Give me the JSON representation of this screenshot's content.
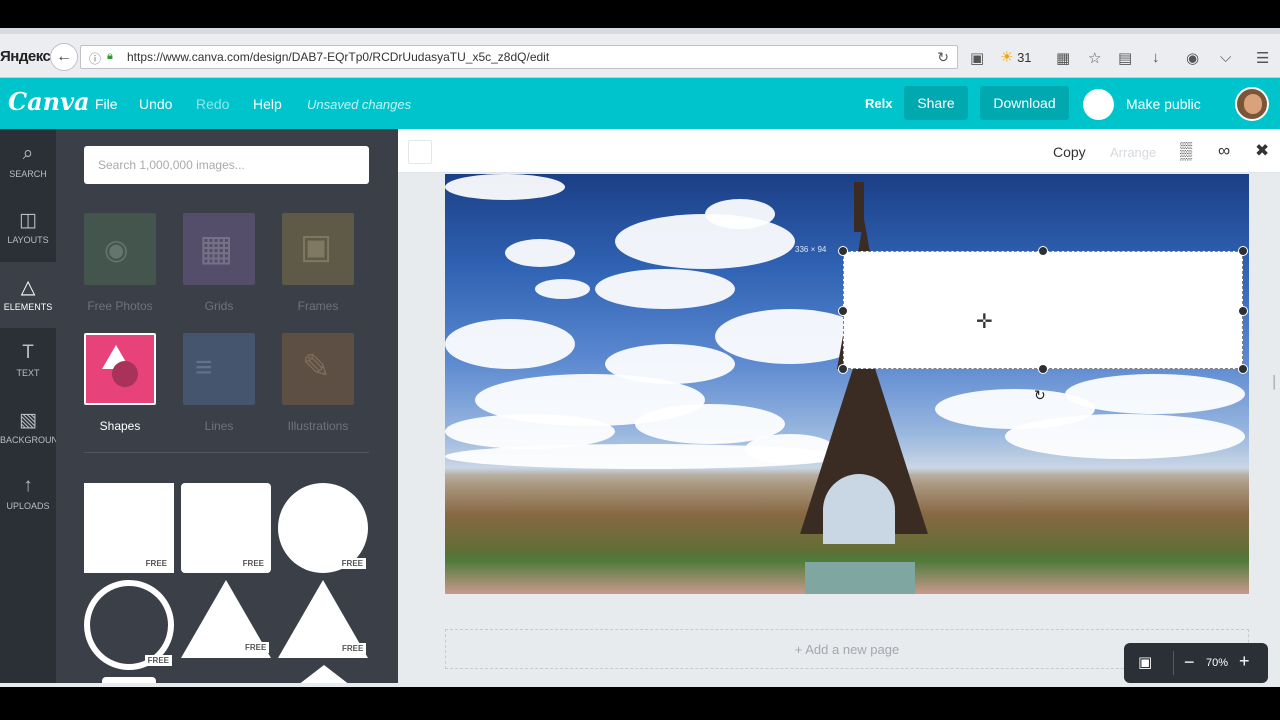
{
  "browser": {
    "brand": "Яндекс",
    "url": "https://www.canva.com/design/DAB7-EQrTp0/RCDrUudasyaTU_x5c_z8dQ/edit",
    "weather_temp": "31"
  },
  "header": {
    "logo": "Canva",
    "menu": {
      "file": "File",
      "undo": "Undo",
      "redo": "Redo",
      "help": "Help"
    },
    "status": "Unsaved changes",
    "relx": "Relx",
    "share": "Share",
    "download": "Download",
    "make_public": "Make public"
  },
  "leftnav": [
    {
      "label": "SEARCH",
      "icon": "search-icon"
    },
    {
      "label": "LAYOUTS",
      "icon": "layouts-icon"
    },
    {
      "label": "ELEMENTS",
      "icon": "elements-icon"
    },
    {
      "label": "TEXT",
      "icon": "text-icon"
    },
    {
      "label": "BACKGROUND",
      "icon": "background-icon"
    },
    {
      "label": "UPLOADS",
      "icon": "upload-icon"
    }
  ],
  "panel": {
    "search_placeholder": "Search 1,000,000 images...",
    "categories": [
      {
        "label": "Free Photos"
      },
      {
        "label": "Grids"
      },
      {
        "label": "Frames"
      },
      {
        "label": "Shapes"
      },
      {
        "label": "Lines"
      },
      {
        "label": "Illustrations"
      }
    ],
    "free_badge": "FREE"
  },
  "canvas": {
    "copy": "Copy",
    "arrange": "Arrange",
    "selection_size": "336 × 94",
    "add_page": "+ Add a new page",
    "zoom": "70%"
  },
  "colors": {
    "brand": "#00c4cc",
    "brand_button": "#00a9b0",
    "nav": "#2b2f36",
    "panel": "#3b4048",
    "shapes_tile": "#e8427b"
  }
}
